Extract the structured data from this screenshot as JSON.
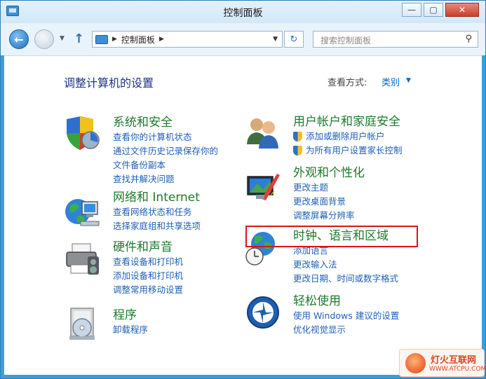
{
  "window": {
    "title": "控制面板"
  },
  "title_buttons": {
    "minimize": "—",
    "maximize": "▢",
    "close": "✕"
  },
  "nav": {
    "breadcrumb": "控制面板",
    "search_placeholder": "搜索控制面板"
  },
  "header": {
    "title": "调整计算机的设置",
    "view_by_label": "查看方式:",
    "view_by_value": "类别"
  },
  "categories": [
    {
      "title": "系统和安全",
      "links": [
        "查看你的计算机状态",
        "通过文件历史记录保存你的",
        "文件备份副本",
        "查找并解决问题"
      ]
    },
    {
      "title": "网络和 Internet",
      "links": [
        "查看网络状态和任务",
        "选择家庭组和共享选项"
      ]
    },
    {
      "title": "硬件和声音",
      "links": [
        "查看设备和打印机",
        "添加设备和打印机",
        "调整常用移动设置"
      ]
    },
    {
      "title": "程序",
      "links": [
        "卸载程序"
      ]
    },
    {
      "title": "用户帐户和家庭安全",
      "links": [
        "添加或删除用户帐户",
        "为所有用户设置家长控制"
      ]
    },
    {
      "title": "外观和个性化",
      "links": [
        "更改主题",
        "更改桌面背景",
        "调整屏幕分辨率"
      ]
    },
    {
      "title": "时钟、语言和区域",
      "links": [
        "添加语言",
        "更改输入法",
        "更改日期、时间或数字格式"
      ]
    },
    {
      "title": "轻松使用",
      "links": [
        "使用 Windows 建议的设置",
        "优化视觉显示"
      ]
    }
  ],
  "watermark": {
    "line1": "灯火互联网",
    "line2": "WWW.ATCPU.COM"
  },
  "colors": {
    "category_title": "#1d7a2a",
    "link": "#1d5fb8",
    "highlight": "#d8141c"
  }
}
